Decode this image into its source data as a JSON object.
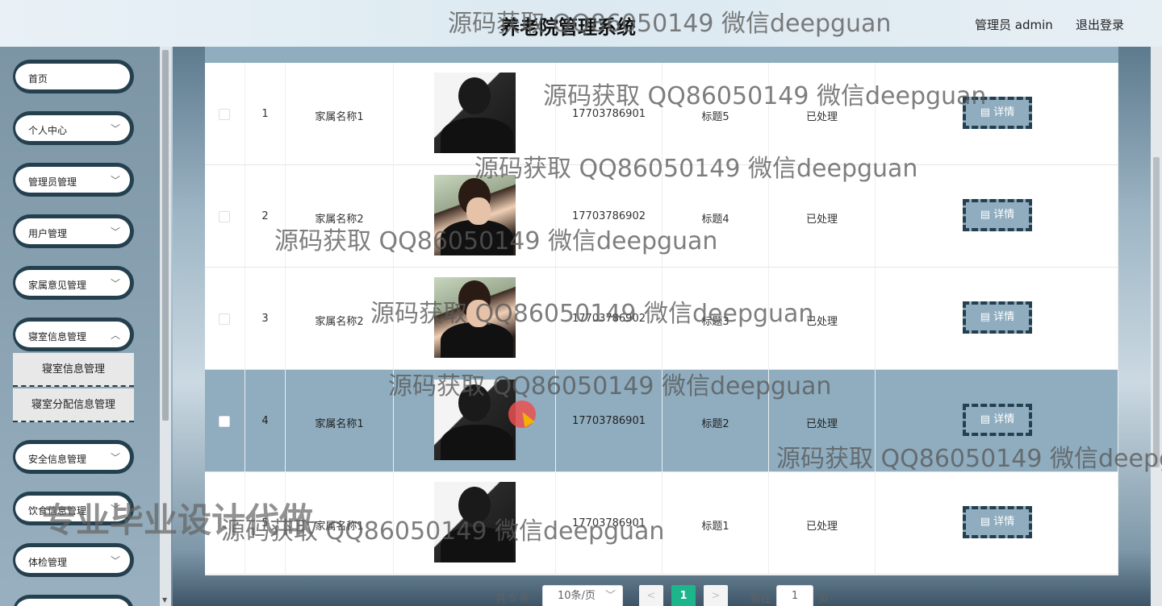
{
  "header": {
    "title": "养老院管理系统",
    "user": "管理员 admin",
    "logout": "退出登录"
  },
  "sidebar": {
    "items": [
      {
        "label": "首页",
        "chevron": false
      },
      {
        "label": "个人中心",
        "chevron": true
      },
      {
        "label": "管理员管理",
        "chevron": true
      },
      {
        "label": "用户管理",
        "chevron": true
      },
      {
        "label": "家属意见管理",
        "chevron": true
      },
      {
        "label": "寝室信息管理",
        "chevron": true,
        "expanded": true
      },
      {
        "label": "安全信息管理",
        "chevron": true
      },
      {
        "label": "饮食信息管理",
        "chevron": true
      },
      {
        "label": "体检管理",
        "chevron": true
      }
    ],
    "subitems": [
      {
        "label": "寝室信息管理"
      },
      {
        "label": "寝室分配信息管理"
      }
    ]
  },
  "table": {
    "rows": [
      {
        "index": "1",
        "name": "家属名称1",
        "phone": "17703786901",
        "title": "标题5",
        "status": "已处理",
        "detail": "详情",
        "avatar": "a",
        "highlight": false
      },
      {
        "index": "2",
        "name": "家属名称2",
        "phone": "17703786902",
        "title": "标题4",
        "status": "已处理",
        "detail": "详情",
        "avatar": "b",
        "highlight": false
      },
      {
        "index": "3",
        "name": "家属名称2",
        "phone": "17703786902",
        "title": "标题3",
        "status": "已处理",
        "detail": "详情",
        "avatar": "b",
        "highlight": false
      },
      {
        "index": "4",
        "name": "家属名称1",
        "phone": "17703786901",
        "title": "标题2",
        "status": "已处理",
        "detail": "详情",
        "avatar": "a",
        "highlight": true
      },
      {
        "index": "5",
        "name": "家属名称1",
        "phone": "17703786901",
        "title": "标题1",
        "status": "已处理",
        "detail": "详情",
        "avatar": "a",
        "highlight": false
      }
    ],
    "detail_icon": "document-icon"
  },
  "pager": {
    "total": "共 5 条",
    "page_size": "10条/页",
    "prev": "<",
    "current": "1",
    "next": ">",
    "goto": "前往",
    "goto_value": "1",
    "page_label": "页"
  },
  "watermarks": [
    "源码获取 QQ86050149 微信deepguan",
    "源码获取 QQ86050149 微信deepguan",
    "源码获取 QQ86050149 微信deepguan",
    "源码获取 QQ86050149 微信deepguan",
    "源码获取 QQ86050149 微信deepguan",
    "源码获取 QQ86050149 微信deepguan",
    "源码获取 QQ86050149 微信deepg",
    "源码获取 QQ86050149 微信deepguan"
  ],
  "promo": "专业毕业设计代做"
}
